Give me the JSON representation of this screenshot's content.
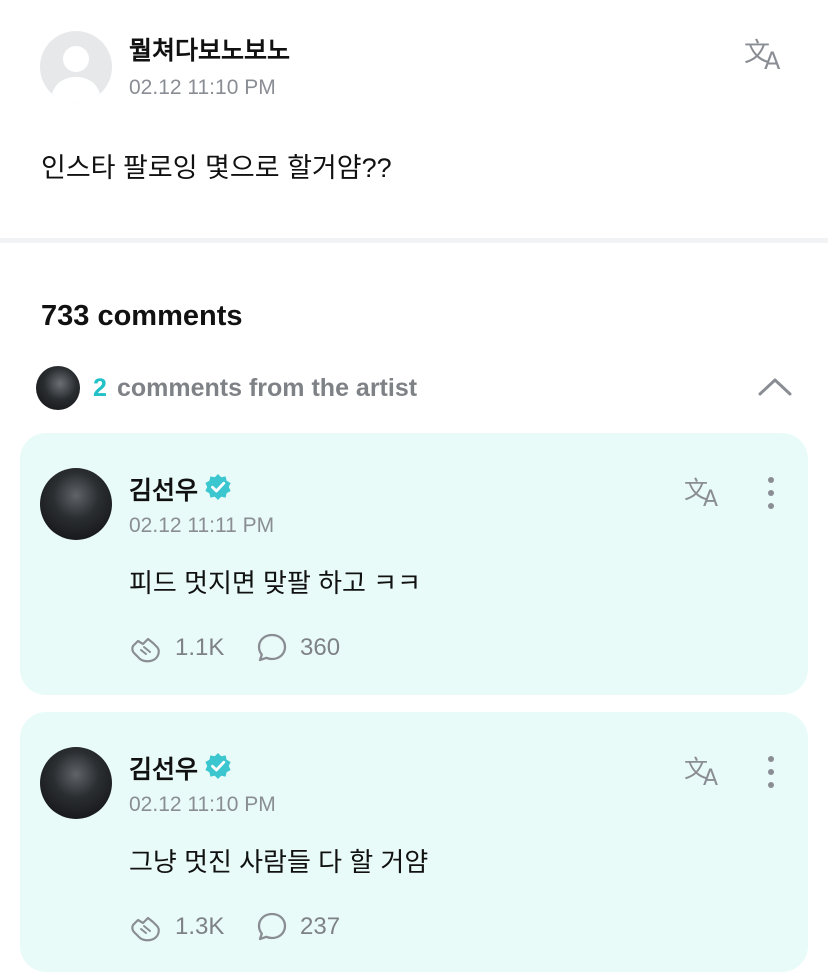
{
  "post": {
    "author": "뭘쳐다보노보노",
    "timestamp": "02.12 11:10 PM",
    "body": "인스타 팔로잉 몇으로 할거얌??"
  },
  "comments_header": {
    "count_label": "733 comments"
  },
  "artist_comments": {
    "count": "2",
    "label": "comments from the artist"
  },
  "comments": [
    {
      "author": "김선우",
      "verified": true,
      "timestamp": "02.12 11:11 PM",
      "body": "피드 멋지면 맞팔 하고 ㅋㅋ",
      "likes": "1.1K",
      "replies": "360"
    },
    {
      "author": "김선우",
      "verified": true,
      "timestamp": "02.12 11:10 PM",
      "body": "그냥 멋진 사람들 다 할 거얌",
      "likes": "1.3K",
      "replies": "237"
    }
  ],
  "icons": {
    "translate": "translate-icon",
    "more": "more-vertical-icon",
    "like": "like-hand-icon",
    "reply": "comment-bubble-icon",
    "collapse": "chevron-up-icon",
    "verified": "verified-badge-icon"
  },
  "colors": {
    "accent": "#22c0c7",
    "card_background": "#e8fbf8",
    "muted_text": "#8a8e94"
  }
}
